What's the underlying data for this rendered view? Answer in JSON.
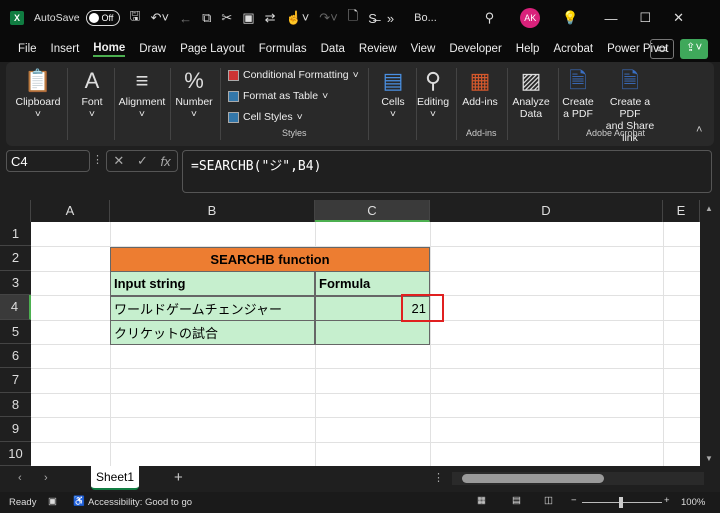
{
  "titlebar": {
    "app_icon": "X",
    "autosave_label": "AutoSave",
    "autosave_state": "Off",
    "filename": "Bo...",
    "avatar": "AK",
    "overflow": "»"
  },
  "menu": [
    "File",
    "Insert",
    "Home",
    "Draw",
    "Page Layout",
    "Formulas",
    "Data",
    "Review",
    "View",
    "Developer",
    "Help",
    "Acrobat",
    "Power Pivot"
  ],
  "ribbon": {
    "clipboard": "Clipboard",
    "font": "Font",
    "alignment": "Alignment",
    "number": "Number",
    "conditional_formatting": "Conditional Formatting",
    "format_as_table": "Format as Table",
    "cell_styles": "Cell Styles",
    "styles_group": "Styles",
    "cells": "Cells",
    "editing": "Editing",
    "addins": "Add-ins",
    "addins_group": "Add-ins",
    "analyze_data_1": "Analyze",
    "analyze_data_2": "Data",
    "create_pdf_1": "Create",
    "create_pdf_2": "a PDF",
    "create_share_1": "Create a PDF",
    "create_share_2": "and Share link",
    "acrobat_group": "Adobe Acrobat"
  },
  "formula_bar": {
    "name_box": "C4",
    "fx": "fx",
    "formula": "=SEARCHB(\"ジ\",B4)"
  },
  "columns": [
    "A",
    "B",
    "C",
    "D",
    "E"
  ],
  "rows": [
    "1",
    "2",
    "3",
    "4",
    "5",
    "6",
    "7",
    "8",
    "9",
    "10"
  ],
  "table": {
    "title": "SEARCHB function",
    "headers": [
      "Input string",
      "Formula"
    ],
    "rows": [
      [
        "ワールドゲームチェンジャー",
        "21"
      ],
      [
        "クリケットの試合",
        ""
      ]
    ]
  },
  "colors": {
    "title_fill": "#ed7d31",
    "body_fill": "#c6efce",
    "highlight": "#e02020"
  },
  "sheet_tabs": [
    "Sheet1"
  ],
  "status": {
    "ready": "Ready",
    "accessibility": "Accessibility: Good to go",
    "zoom": "100%"
  }
}
